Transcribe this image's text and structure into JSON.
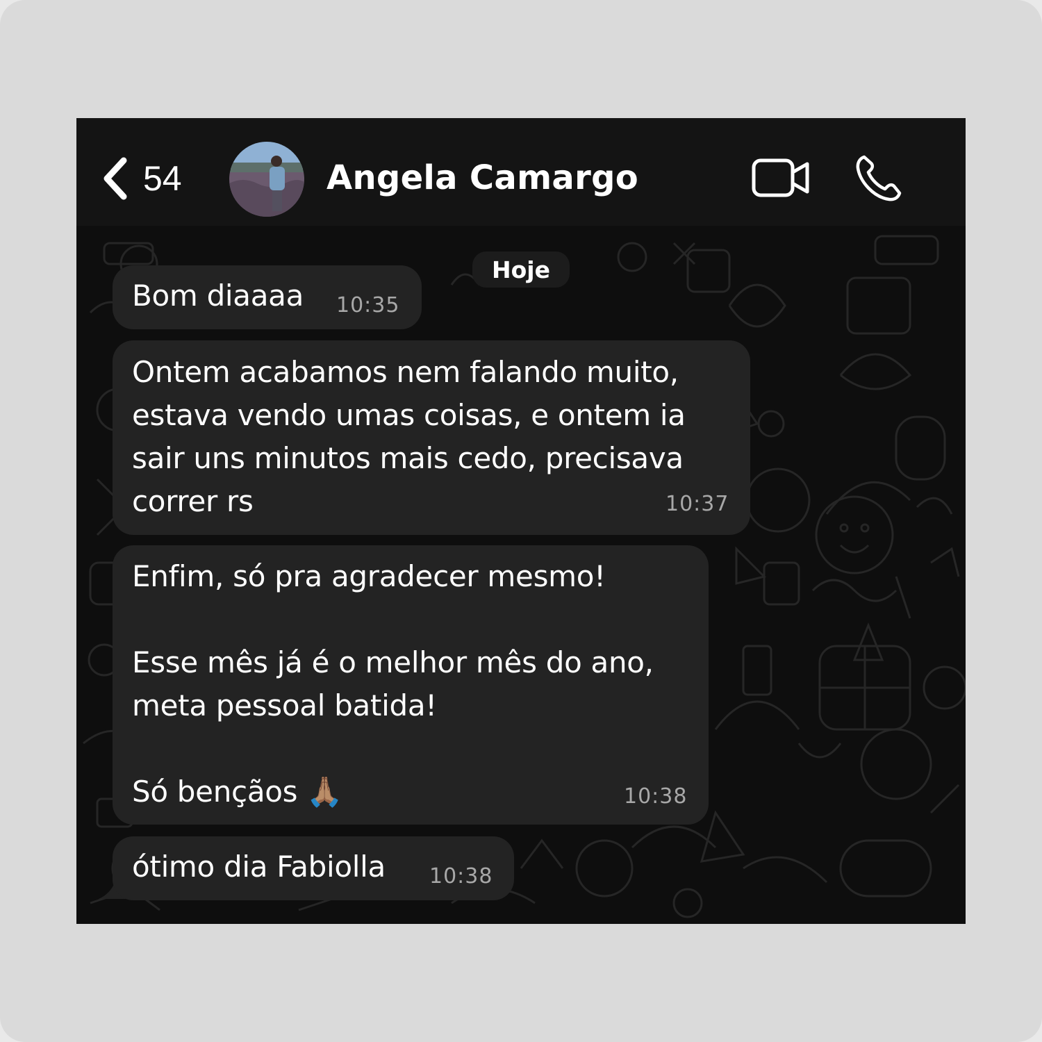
{
  "header": {
    "back_count": "54",
    "contact_name": "Angela Camargo",
    "icons": {
      "back": "chevron-left-icon",
      "video": "video-camera-icon",
      "call": "phone-icon"
    }
  },
  "date_divider": "Hoje",
  "messages": [
    {
      "text": "Bom diaaaa",
      "time": "10:35"
    },
    {
      "text": "Ontem acabamos nem falando muito,\nestava vendo umas coisas, e ontem ia\nsair uns minutos mais cedo, precisava\ncorrer rs",
      "time": "10:37"
    },
    {
      "text": "Enfim, só pra agradecer mesmo!\n\nEsse mês já é o melhor mês do ano,\nmeta pessoal batida!\n\nSó bençãos 🙏🏽",
      "time": "10:38"
    },
    {
      "text": "ótimo dia Fabiolla",
      "time": "10:38"
    }
  ],
  "colors": {
    "background": "#0e0e0e",
    "bubble": "#232323",
    "header": "#141414",
    "text": "#ffffff",
    "timestamp": "#a8a8a8"
  }
}
